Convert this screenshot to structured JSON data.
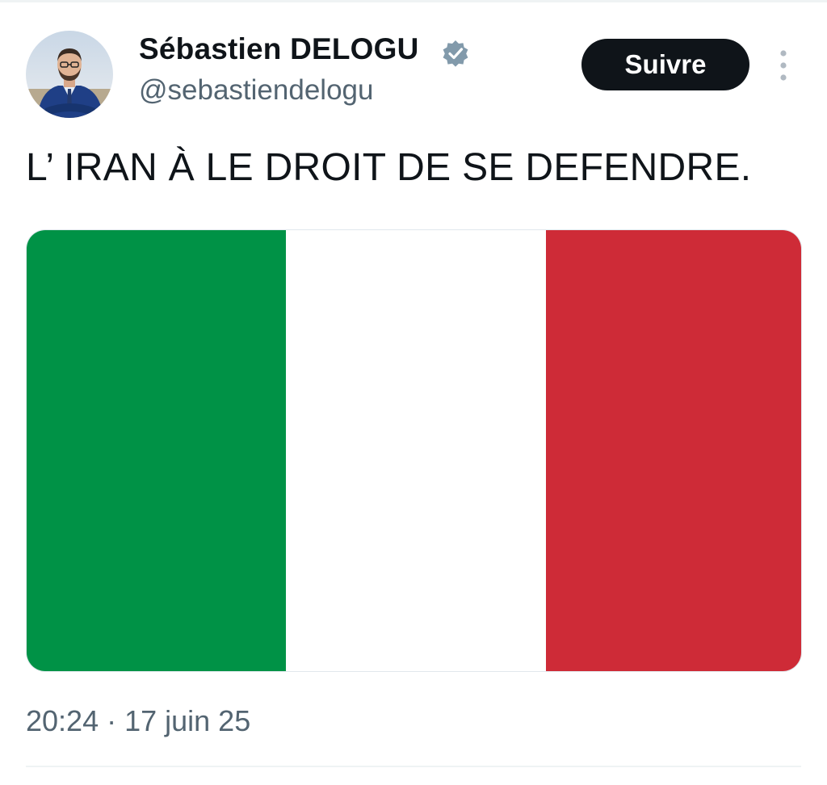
{
  "author": {
    "name": "Sébastien DELOGU",
    "handle": "@sebastiendelogu",
    "verified": true,
    "verified_color": "#829aab"
  },
  "actions": {
    "follow_label": "Suivre",
    "more_icon": "more-vertical-icon"
  },
  "tweet": {
    "text": "L’ IRAN À LE DROIT DE SE DEFENDRE.",
    "timestamp": "20:24 · 17 juin 25"
  },
  "media": {
    "type": "flag-image",
    "stripe_colors": [
      "#009246",
      "#ffffff",
      "#ce2b37"
    ]
  },
  "colors": {
    "text_primary": "#0f1419",
    "text_secondary": "#536471",
    "button_bg": "#0f1419",
    "button_text": "#ffffff"
  }
}
